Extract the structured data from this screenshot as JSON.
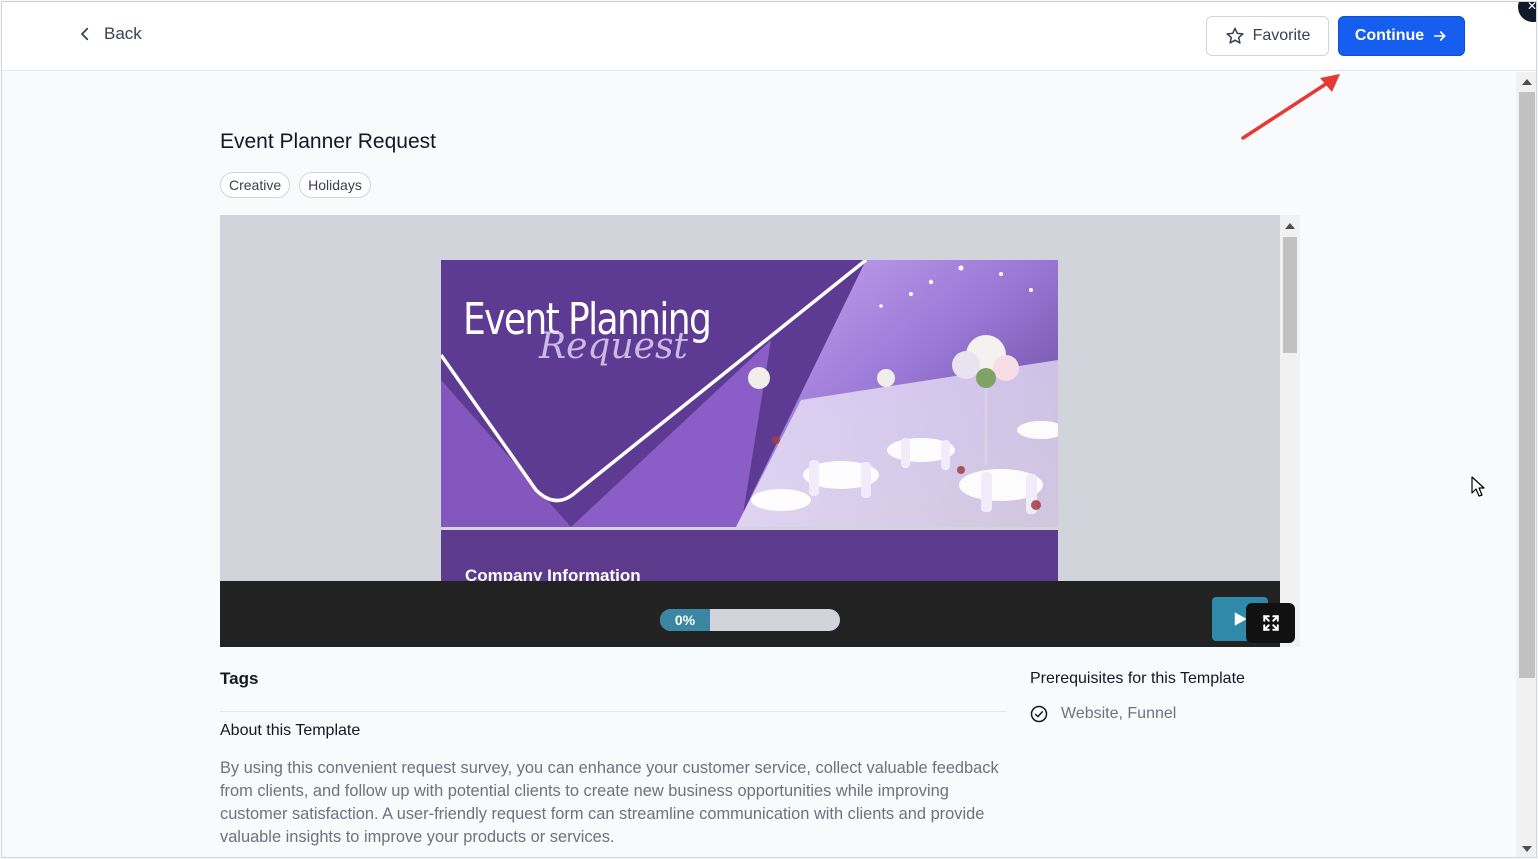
{
  "header": {
    "back_label": "Back",
    "favorite_label": "Favorite",
    "continue_label": "Continue"
  },
  "template": {
    "title": "Event Planner Request",
    "chips": [
      "Creative",
      "Holidays"
    ]
  },
  "preview": {
    "banner_headline": "Event Planning",
    "banner_script": "Request",
    "section_heading": "Company Information",
    "progress_label": "0%",
    "progress_value": 0
  },
  "details": {
    "tags_heading": "Tags",
    "about_heading": "About this Template",
    "about_text": "By using this convenient request survey, you can enhance your customer service, collect valuable feedback from clients, and follow up with potential clients to create new business opportunities while improving customer satisfaction. A user-friendly request form can streamline communication with clients and provide valuable insights to improve your products or services.",
    "prereq_heading": "Prerequisites for this Template",
    "prereq_item": "Website, Funnel"
  },
  "colors": {
    "primary": "#155eef",
    "annotation_arrow": "#e53935",
    "banner_purple": "#6b3fa0",
    "progress_teal": "#3b87a3"
  },
  "icons": {
    "back": "chevron-left-icon",
    "favorite": "star-icon",
    "continue": "arrow-right-icon",
    "play": "play-icon",
    "expand": "expand-icon",
    "prereq": "check-circle-icon"
  }
}
